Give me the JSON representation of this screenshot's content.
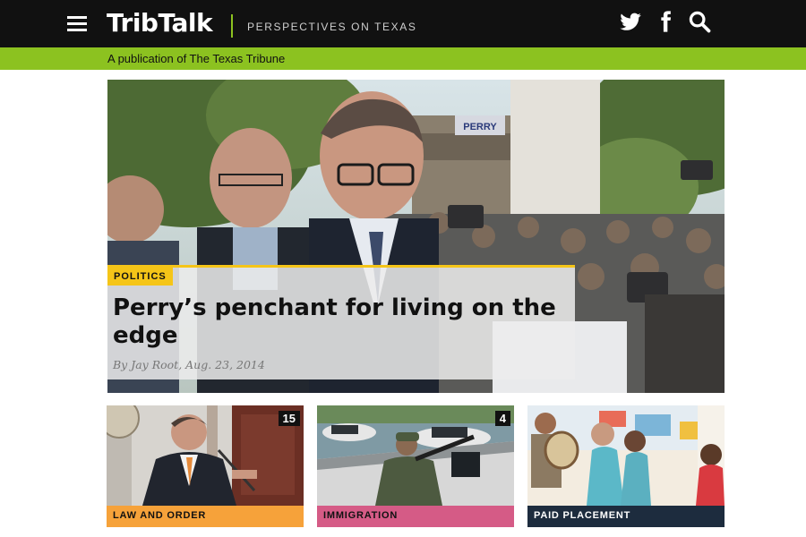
{
  "header": {
    "logo": "TribTalk",
    "tagline": "PERSPECTIVES ON TEXAS",
    "icons": [
      "menu-icon",
      "twitter-icon",
      "facebook-icon",
      "search-icon"
    ]
  },
  "publication_note": "A publication of The Texas Tribune",
  "hero": {
    "category": "POLITICS",
    "title": "Perry’s penchant for living on the edge",
    "byline": "By Jay Root, Aug. 23, 2014",
    "sign_text": "PERRY"
  },
  "cards": [
    {
      "category": "LAW AND ORDER",
      "count": "15"
    },
    {
      "category": "IMMIGRATION",
      "count": "4"
    },
    {
      "category": "PAID PLACEMENT",
      "count": ""
    }
  ],
  "colors": {
    "topbar": "#111111",
    "accent_green": "#8cc220",
    "politics_yellow": "#f5c518",
    "law_orange": "#f6a23a",
    "immigration_pink": "#d55b86",
    "paid_navy": "#1d2c3e"
  }
}
